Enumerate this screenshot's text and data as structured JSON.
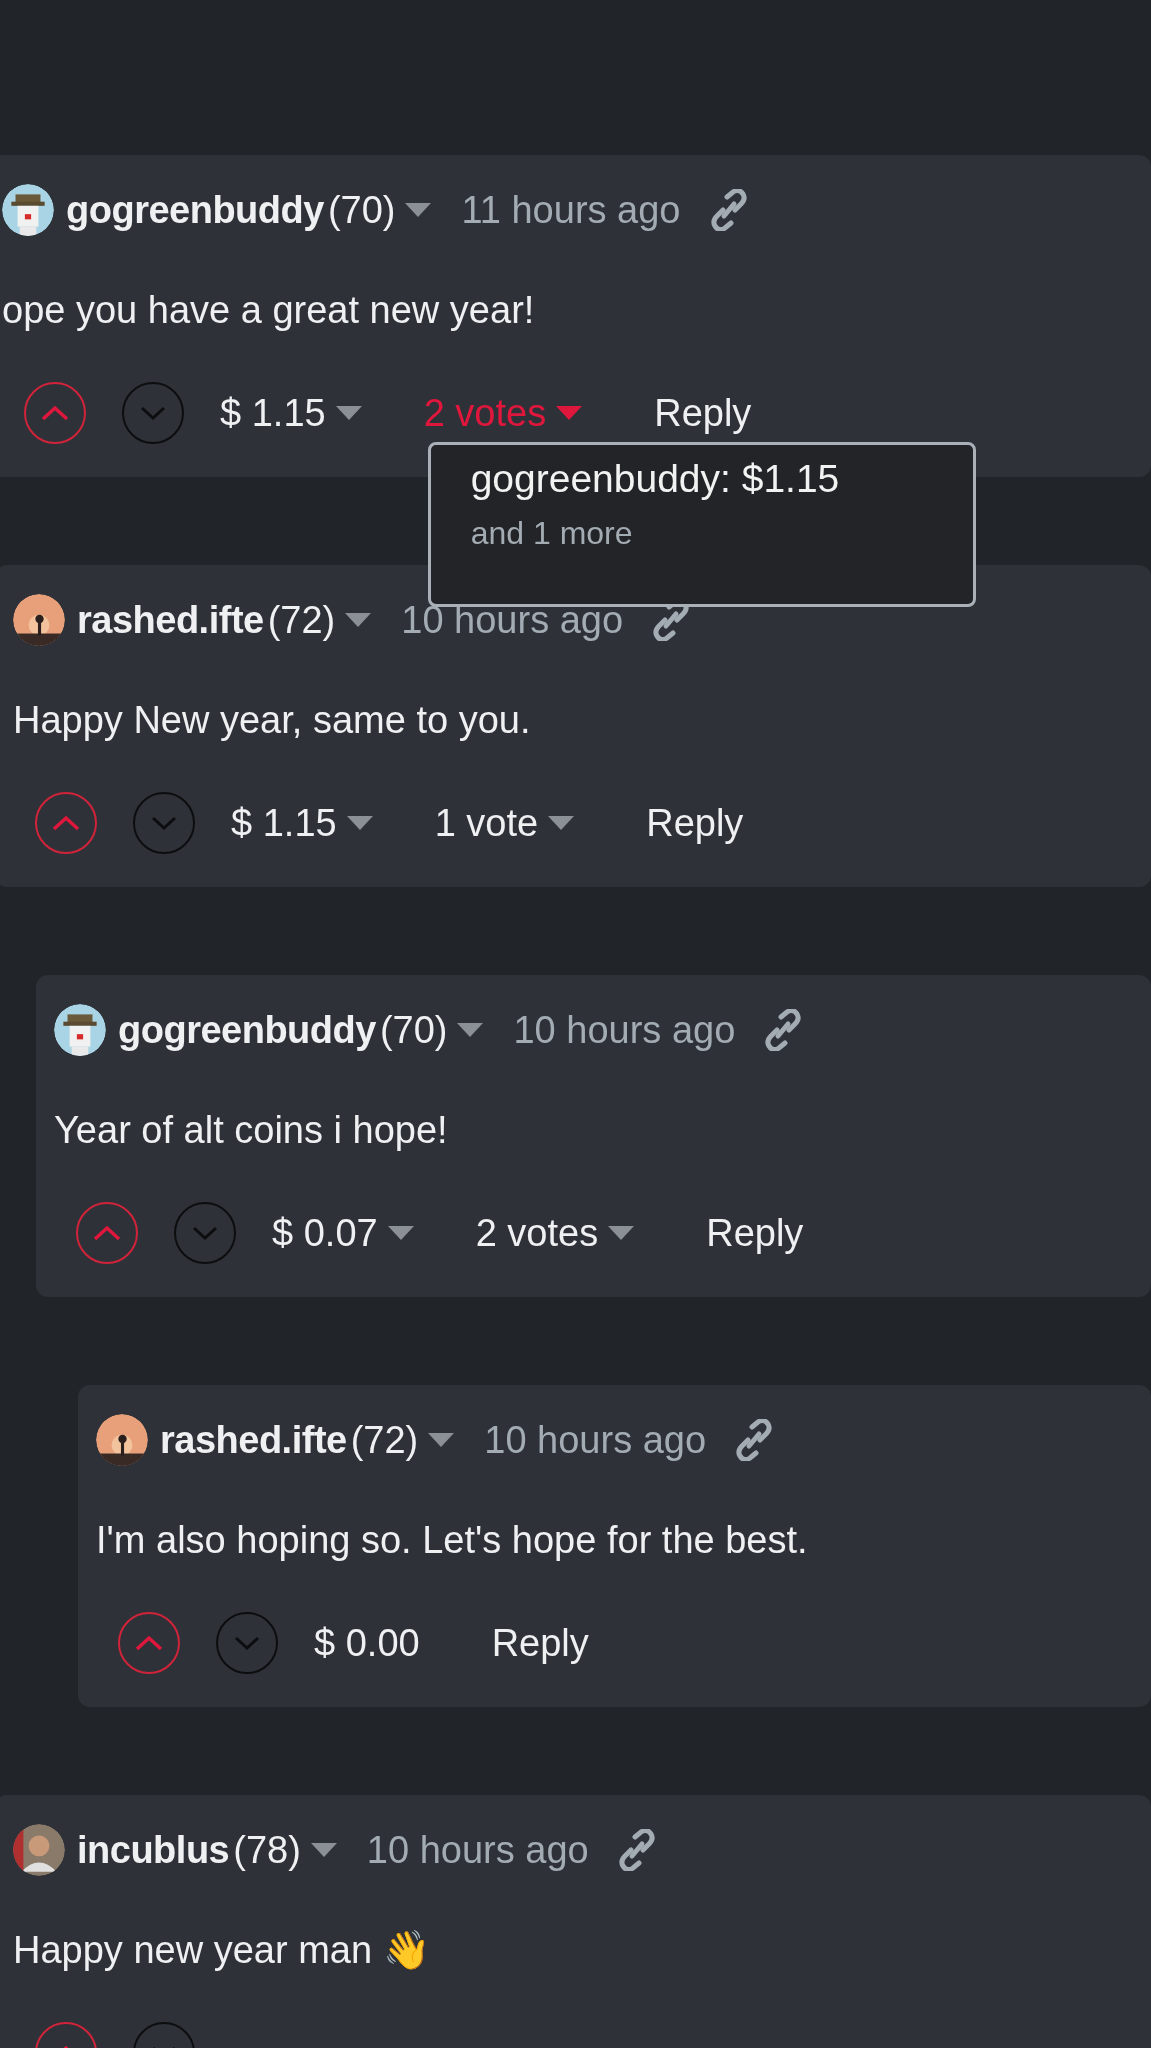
{
  "comments": [
    {
      "user": "gogreenbuddy",
      "reputation": "(70)",
      "time": "11 hours ago",
      "body": "ope you have a great new year!",
      "payout": {
        "amount": "$ 1.15",
        "menu": true
      },
      "votes": {
        "label": "2 votes",
        "open": true,
        "tooltip": {
          "voter": "gogreenbuddy: $1.15",
          "more": "and 1 more"
        }
      },
      "reply": "Reply",
      "children": [
        {
          "user": "rashed.ifte",
          "reputation": "(72)",
          "time": "10 hours ago",
          "body": "Happy New year, same to you.",
          "payout": {
            "amount": "$ 1.15",
            "menu": true
          },
          "votes": {
            "label": "1 vote",
            "open": false
          },
          "reply": "Reply",
          "children": [
            {
              "user": "gogreenbuddy",
              "reputation": "(70)",
              "time": "10 hours ago",
              "body": "Year of alt coins i hope!",
              "payout": {
                "amount": "$ 0.07",
                "menu": true
              },
              "votes": {
                "label": "2 votes",
                "open": false
              },
              "reply": "Reply",
              "children": [
                {
                  "user": "rashed.ifte",
                  "reputation": "(72)",
                  "time": "10 hours ago",
                  "body": "I'm also hoping so. Let's hope for the best.",
                  "payout": {
                    "amount": "$ 0.00",
                    "menu": false
                  },
                  "reply": "Reply"
                }
              ]
            }
          ]
        },
        {
          "user": "incublus",
          "reputation": "(78)",
          "time": "10 hours ago",
          "body": "Happy new year man 👋"
        }
      ]
    }
  ]
}
